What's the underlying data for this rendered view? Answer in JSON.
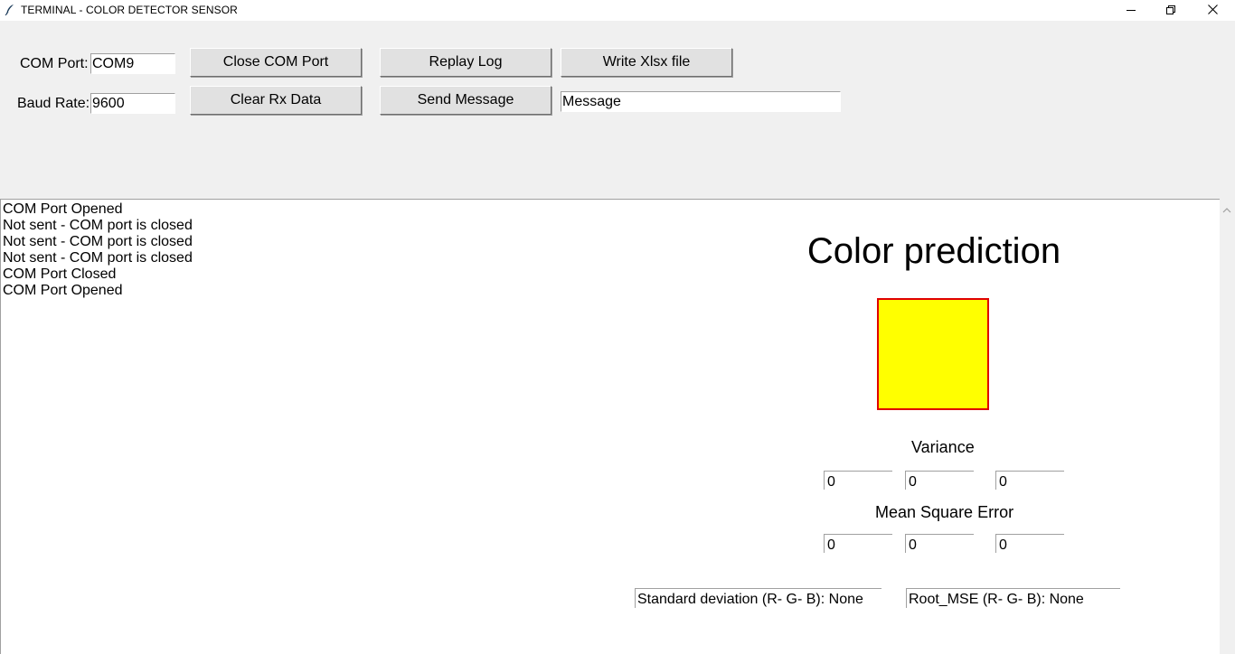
{
  "window": {
    "title": "TERMINAL - COLOR DETECTOR SENSOR",
    "icon": "feather-icon",
    "controls": [
      "minimize-icon",
      "restore-icon",
      "close-icon"
    ]
  },
  "toolbar": {
    "com_port_label": "COM Port:",
    "com_port_value": "COM9",
    "baud_rate_label": "Baud Rate:",
    "baud_rate_value": "9600",
    "close_com_port": "Close COM Port",
    "clear_rx_data": "Clear Rx Data",
    "replay_log": "Replay Log",
    "send_message": "Send Message",
    "write_xlsx": "Write Xlsx file",
    "message_value": "Message"
  },
  "log": {
    "lines": [
      "COM Port Opened",
      "Not sent - COM port is closed",
      "Not sent - COM port is closed",
      "Not sent - COM port is closed",
      "COM Port Closed",
      "COM Port Opened"
    ]
  },
  "prediction": {
    "title": "Color prediction",
    "swatch_color": "#ffff00",
    "swatch_border_color": "#e00000",
    "variance_label": "Variance",
    "variance_values": [
      "0",
      "0",
      "0"
    ],
    "mse_label": "Mean Square Error",
    "mse_values": [
      "0",
      "0",
      "0"
    ],
    "std_dev_text": "Standard deviation (R- G- B): None",
    "root_mse_text": "Root_MSE (R- G- B): None"
  }
}
